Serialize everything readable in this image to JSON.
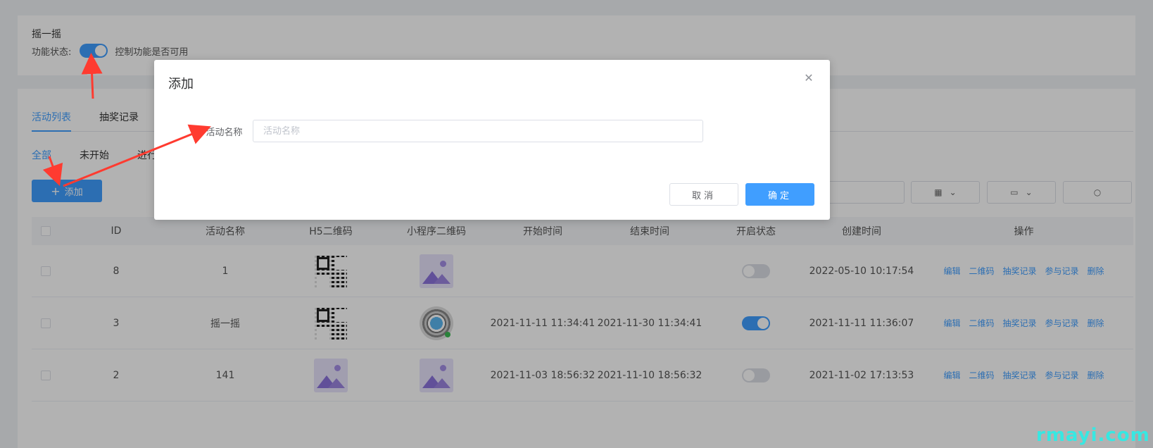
{
  "feature": {
    "title": "摇一摇",
    "status_label": "功能状态:",
    "status_on": true,
    "status_hint": "控制功能是否可用"
  },
  "tabs": [
    {
      "label": "活动列表",
      "active": true
    },
    {
      "label": "抽奖记录",
      "active": false
    }
  ],
  "subtabs": [
    {
      "label": "全部",
      "active": true
    },
    {
      "label": "未开始",
      "active": false
    },
    {
      "label": "进行",
      "active": false
    }
  ],
  "add_button": {
    "label": "添加",
    "icon": "plus-icon"
  },
  "toolbar": {
    "icons": [
      "grid-icon",
      "chevron-down-icon",
      "folder-icon",
      "search-icon"
    ]
  },
  "table": {
    "columns": [
      "ID",
      "活动名称",
      "H5二维码",
      "小程序二维码",
      "开始时间",
      "结束时间",
      "开启状态",
      "创建时间",
      "操作"
    ],
    "rows": [
      {
        "id": "8",
        "name": "1",
        "h5": "qr",
        "mini": "placeholder",
        "start": "",
        "end": "",
        "state_on": false,
        "created": "2022-05-10 10:17:54"
      },
      {
        "id": "3",
        "name": "摇一摇",
        "h5": "qr",
        "mini": "miniqr",
        "start": "2021-11-11 11:34:41",
        "end": "2021-11-30 11:34:41",
        "state_on": true,
        "created": "2021-11-11 11:36:07"
      },
      {
        "id": "2",
        "name": "141",
        "h5": "placeholder",
        "mini": "placeholder",
        "start": "2021-11-03 18:56:32",
        "end": "2021-11-10 18:56:32",
        "state_on": false,
        "created": "2021-11-02 17:13:53"
      }
    ],
    "ops": [
      "编辑",
      "二维码",
      "抽奖记录",
      "参与记录",
      "删除"
    ]
  },
  "dialog": {
    "title": "添加",
    "field_label": "活动名称",
    "field_placeholder": "活动名称",
    "field_value": "",
    "cancel_label": "取消",
    "ok_label": "确定"
  },
  "colors": {
    "accent": "#409eff",
    "arrow": "#ff3b30",
    "watermark": "#37e8e2"
  },
  "watermark": "rmayi.com"
}
